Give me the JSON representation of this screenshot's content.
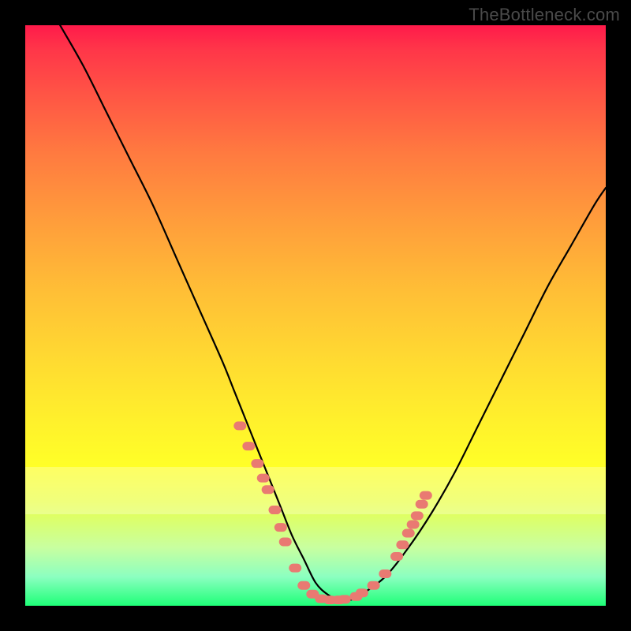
{
  "watermark": "TheBottleneck.com",
  "chart_data": {
    "type": "line",
    "title": "",
    "xlabel": "",
    "ylabel": "",
    "xlim": [
      0,
      100
    ],
    "ylim": [
      0,
      100
    ],
    "grid": false,
    "legend": false,
    "series": [
      {
        "name": "curve",
        "color": "#000000",
        "x": [
          6,
          10,
          14,
          18,
          22,
          26,
          30,
          34,
          36,
          38,
          40,
          42,
          44,
          46,
          48,
          50,
          52,
          54,
          56,
          58,
          62,
          66,
          70,
          74,
          78,
          82,
          86,
          90,
          94,
          98,
          100
        ],
        "y": [
          100,
          93,
          85,
          77,
          69,
          60,
          51,
          42,
          37,
          32,
          27,
          22,
          17,
          12,
          8,
          4,
          2,
          1,
          1,
          2,
          5,
          10,
          16,
          23,
          31,
          39,
          47,
          55,
          62,
          69,
          72
        ]
      }
    ],
    "markers": {
      "name": "dots",
      "color": "#e97a72",
      "points": [
        {
          "x": 37.0,
          "y": 31.0
        },
        {
          "x": 38.5,
          "y": 27.5
        },
        {
          "x": 40.0,
          "y": 24.5
        },
        {
          "x": 41.0,
          "y": 22.0
        },
        {
          "x": 41.8,
          "y": 20.0
        },
        {
          "x": 43.0,
          "y": 16.5
        },
        {
          "x": 44.0,
          "y": 13.5
        },
        {
          "x": 44.8,
          "y": 11.0
        },
        {
          "x": 46.5,
          "y": 6.5
        },
        {
          "x": 48.0,
          "y": 3.5
        },
        {
          "x": 49.5,
          "y": 2.0
        },
        {
          "x": 51.0,
          "y": 1.2
        },
        {
          "x": 52.5,
          "y": 1.0
        },
        {
          "x": 54.0,
          "y": 1.0
        },
        {
          "x": 55.0,
          "y": 1.1
        },
        {
          "x": 57.0,
          "y": 1.6
        },
        {
          "x": 58.0,
          "y": 2.2
        },
        {
          "x": 60.0,
          "y": 3.5
        },
        {
          "x": 62.0,
          "y": 5.5
        },
        {
          "x": 64.0,
          "y": 8.5
        },
        {
          "x": 65.0,
          "y": 10.5
        },
        {
          "x": 66.0,
          "y": 12.5
        },
        {
          "x": 66.8,
          "y": 14.0
        },
        {
          "x": 67.5,
          "y": 15.5
        },
        {
          "x": 68.3,
          "y": 17.5
        },
        {
          "x": 69.0,
          "y": 19.0
        }
      ]
    }
  }
}
